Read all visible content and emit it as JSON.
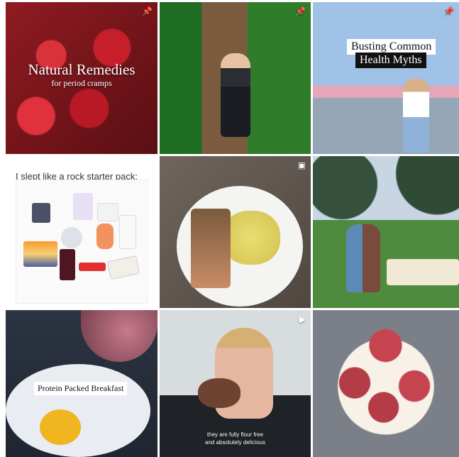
{
  "tiles": {
    "tile1": {
      "title": "Natural Remedies",
      "subtitle": "for period cramps",
      "badge": "pin-icon"
    },
    "tile2": {
      "badge": "pin-icon"
    },
    "tile3": {
      "line1": "Busting Common",
      "line2": "Health Myths",
      "badge": "pin-icon"
    },
    "tile4": {
      "text": "I slept like a rock starter pack:"
    },
    "tile5": {
      "badge": "multi-image-icon"
    },
    "tile6": {
      "badge": "multi-image-icon"
    },
    "tile7": {
      "label": "Protein Packed Breakfast",
      "badge": "video-icon"
    },
    "tile8": {
      "subtitle_line1": "they are fully flour free",
      "subtitle_line2": "and absolutely delicious",
      "badge": "video-icon"
    },
    "tile9": {}
  }
}
